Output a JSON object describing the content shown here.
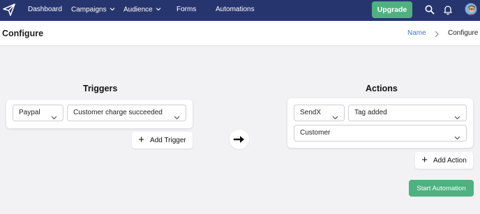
{
  "nav": {
    "items": [
      {
        "label": "Dashboard"
      },
      {
        "label": "Campaigns"
      },
      {
        "label": "Audience"
      },
      {
        "label": "Forms"
      },
      {
        "label": "Automations"
      }
    ],
    "upgrade_label": "Upgrade",
    "colors": {
      "bar": "#27356f",
      "upgrade": "#4fb17f"
    }
  },
  "header": {
    "title": "Configure",
    "breadcrumb": {
      "link": "Name",
      "current": "Configure"
    }
  },
  "triggers": {
    "title": "Triggers",
    "source": "Paypal",
    "event": "Customer charge succeeded",
    "add_label": "Add Trigger"
  },
  "actions": {
    "title": "Actions",
    "service": "SendX",
    "action": "Tag added",
    "target": "Customer",
    "add_label": "Add Action",
    "start_label": "Start Automation"
  }
}
